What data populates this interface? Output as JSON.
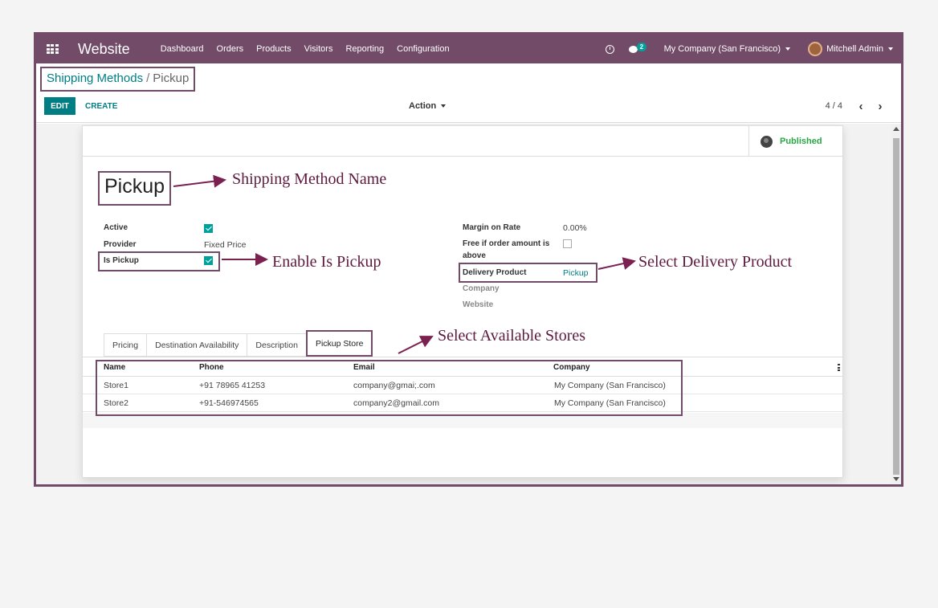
{
  "navbar": {
    "app_name": "Website",
    "menu": [
      "Dashboard",
      "Orders",
      "Products",
      "Visitors",
      "Reporting",
      "Configuration"
    ],
    "chat_count": "2",
    "company": "My Company (San Francisco)",
    "user": "Mitchell Admin"
  },
  "breadcrumb": {
    "parent": "Shipping Methods",
    "separator": "/",
    "current": "Pickup"
  },
  "toolbar": {
    "edit_label": "EDIT",
    "create_label": "CREATE",
    "action_label": "Action",
    "pager": "4 / 4"
  },
  "status": {
    "published_label": "Published"
  },
  "record": {
    "name": "Pickup",
    "fields_left": {
      "active_label": "Active",
      "active": true,
      "provider_label": "Provider",
      "provider_value": "Fixed Price",
      "is_pickup_label": "Is Pickup",
      "is_pickup": true
    },
    "fields_right": {
      "margin_label": "Margin on Rate",
      "margin_value": "0.00%",
      "free_label_line1": "Free if order amount is",
      "free_label_line2": "above",
      "free": false,
      "delivery_product_label": "Delivery Product",
      "delivery_product_value": "Pickup",
      "company_label": "Company",
      "website_label": "Website"
    }
  },
  "tabs": [
    "Pricing",
    "Destination Availability",
    "Description",
    "Pickup Store"
  ],
  "active_tab": "Pickup Store",
  "stores_table": {
    "columns": [
      "Name",
      "Phone",
      "Email",
      "Company"
    ],
    "rows": [
      [
        "Store1",
        "+91 78965 41253",
        "company@gmai;.com",
        "My Company (San Francisco)"
      ],
      [
        "Store2",
        "+91-546974565",
        "company2@gmail.com",
        "My Company (San Francisco)"
      ]
    ]
  },
  "annotations": {
    "name": "Shipping Method Name",
    "is_pickup": "Enable Is Pickup",
    "delivery_product": "Select Delivery Product",
    "stores": "Select Available Stores"
  },
  "colors": {
    "brand": "#714b67",
    "accent": "#017e84",
    "published": "#28a745",
    "annotation": "#5d1a3e"
  }
}
